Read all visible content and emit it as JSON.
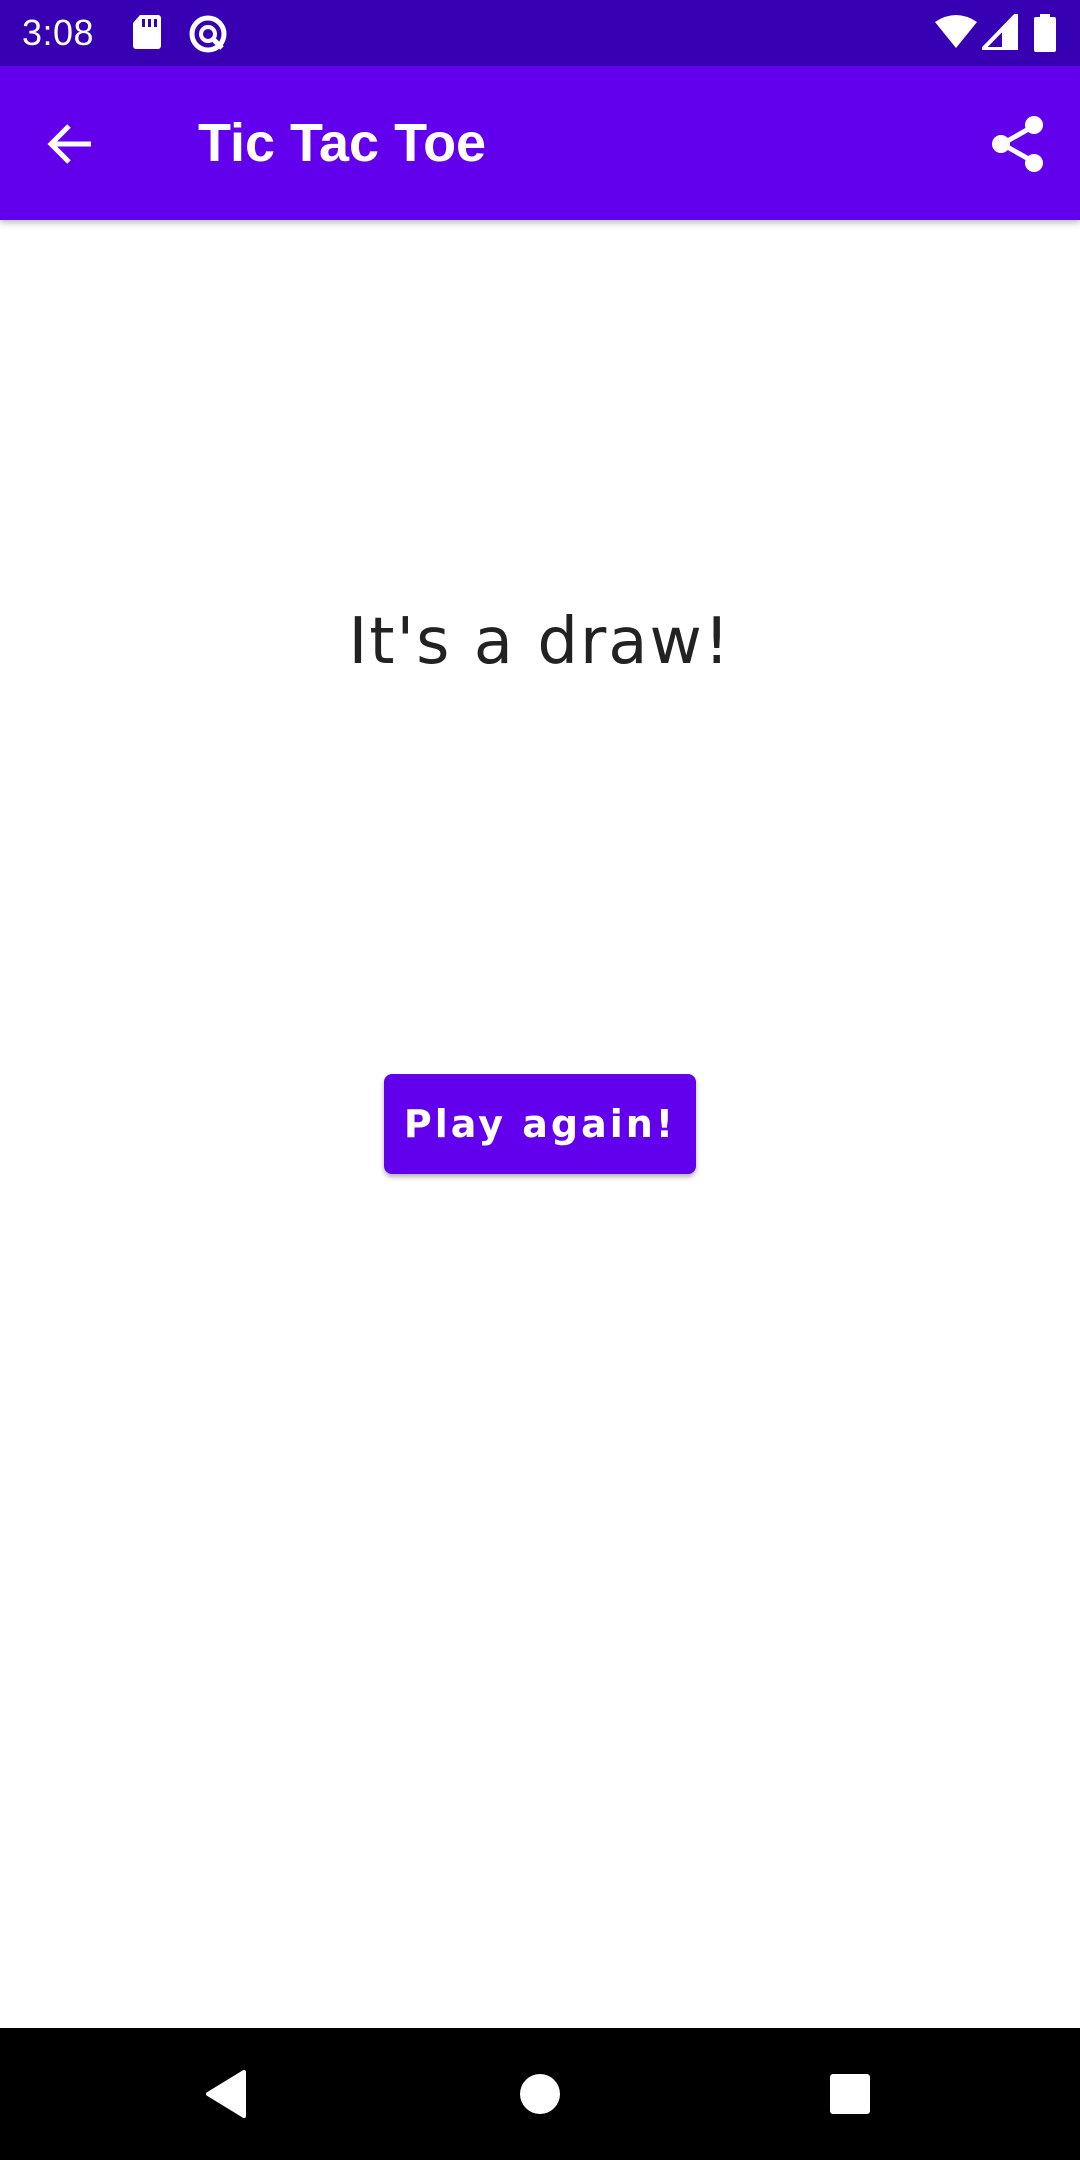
{
  "status_bar": {
    "time": "3:08",
    "icons": [
      "sd-card-icon",
      "sync-icon",
      "wifi-icon",
      "cell-signal-icon",
      "battery-icon"
    ],
    "background": "#3700b3"
  },
  "app_bar": {
    "title": "Tic Tac Toe",
    "back_icon": "arrow-back-icon",
    "share_icon": "share-icon",
    "background": "#6200ee"
  },
  "main": {
    "result_message": "It's a draw!",
    "play_again_label": "Play again!"
  },
  "nav_bar": {
    "icons": [
      "back-triangle-icon",
      "home-circle-icon",
      "recents-square-icon"
    ]
  }
}
